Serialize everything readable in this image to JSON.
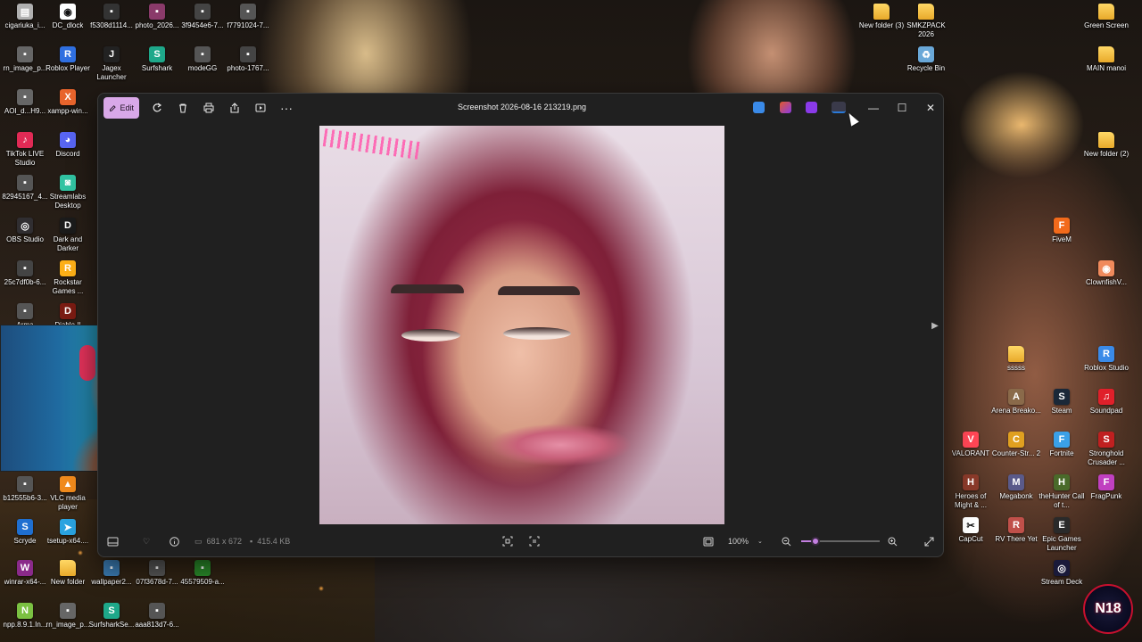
{
  "desktop": {
    "icons_left": [
      {
        "label": "cigariuka_i...",
        "color": "#b0b0b0",
        "glyph": "▤"
      },
      {
        "label": "DC_dlock",
        "color": "#ffffff",
        "glyph": "◉"
      },
      {
        "label": "f5308d1114...",
        "color": "#333333",
        "glyph": "▪"
      },
      {
        "label": "photo_2026...",
        "color": "#8a3a6a",
        "glyph": "▪"
      },
      {
        "label": "3f9454e6-7...",
        "color": "#444444",
        "glyph": "▪"
      },
      {
        "label": "f7791024-7...",
        "color": "#555555",
        "glyph": "▪"
      },
      {
        "label": "rn_image_p...",
        "color": "#666666",
        "glyph": "▪"
      },
      {
        "label": "Roblox Player",
        "color": "#2f6fe0",
        "glyph": "R"
      },
      {
        "label": "Jagex Launcher",
        "color": "#222222",
        "glyph": "J"
      },
      {
        "label": "Surfshark",
        "color": "#1ea88a",
        "glyph": "S"
      },
      {
        "label": "modeGG",
        "color": "#555555",
        "glyph": "▪"
      },
      {
        "label": "photo-1767...",
        "color": "#444444",
        "glyph": "▪"
      },
      {
        "label": "AOI_d...H9...",
        "color": "#666666",
        "glyph": "▪"
      },
      {
        "label": "xampp-win...",
        "color": "#e8642c",
        "glyph": "X"
      },
      {
        "label": "TikTok LIVE Studio",
        "color": "#e12a55",
        "glyph": "♪"
      },
      {
        "label": "Discord",
        "color": "#5865f2",
        "glyph": "◕"
      },
      {
        "label": "82945167_4...",
        "color": "#555555",
        "glyph": "▪"
      },
      {
        "label": "Streamlabs Desktop",
        "color": "#31c3a2",
        "glyph": "◙"
      },
      {
        "label": "OBS Studio",
        "color": "#302e31",
        "glyph": "◎"
      },
      {
        "label": "Dark and Darker",
        "color": "#1b1b1b",
        "glyph": "D"
      },
      {
        "label": "25c7df0b-6...",
        "color": "#444444",
        "glyph": "▪"
      },
      {
        "label": "Rockstar Games ...",
        "color": "#fcaf17",
        "glyph": "R"
      },
      {
        "label": "Arma",
        "color": "#555555",
        "glyph": "▪"
      },
      {
        "label": "Diablo II",
        "color": "#7a1b12",
        "glyph": "D"
      },
      {
        "label": "b12555b6-3...",
        "color": "#555555",
        "glyph": "▪"
      },
      {
        "label": "VLC media player",
        "color": "#f08a1c",
        "glyph": "▲"
      },
      {
        "label": "Scryde",
        "color": "#1f6fd0",
        "glyph": "S"
      },
      {
        "label": "tsetup-x64....",
        "color": "#2aa3e0",
        "glyph": "➤"
      },
      {
        "label": "winrar-x64-...",
        "color": "#8a2a8a",
        "glyph": "W"
      },
      {
        "label": "New folder",
        "color": "#e8a92a",
        "glyph": "folder"
      },
      {
        "label": "wallpaper2...",
        "color": "#3a7ab0",
        "glyph": "▪"
      },
      {
        "label": "07f3678d-7...",
        "color": "#555555",
        "glyph": "▪"
      },
      {
        "label": "45579509-a...",
        "color": "#2a8a2a",
        "glyph": "▪"
      },
      {
        "label": "npp.8.9.1.In...",
        "color": "#7bc142",
        "glyph": "N"
      },
      {
        "label": "rn_image_p...",
        "color": "#666666",
        "glyph": "▪"
      },
      {
        "label": "SurfsharkSe...",
        "color": "#1ea88a",
        "glyph": "S"
      },
      {
        "label": "aaa813d7-6...",
        "color": "#555555",
        "glyph": "▪"
      }
    ],
    "icons_right": [
      {
        "label": "New folder (3)",
        "glyph": "folder"
      },
      {
        "label": "SMKZPACK 2026",
        "glyph": "folder"
      },
      {
        "label": "Green Screen",
        "glyph": "folder"
      },
      {
        "label": "Recycle Bin",
        "color": "#6aa8d8",
        "glyph": "♻"
      },
      {
        "label": "MAIN manoi",
        "glyph": "folder"
      },
      {
        "label": "New folder (2)",
        "glyph": "folder"
      },
      {
        "label": "FiveM",
        "color": "#f26a1b",
        "glyph": "F"
      },
      {
        "label": "ClownfishV...",
        "color": "#f08a5c",
        "glyph": "◉"
      },
      {
        "label": "sssss",
        "glyph": "folder"
      },
      {
        "label": "Roblox Studio",
        "color": "#3a8ae8",
        "glyph": "R"
      },
      {
        "label": "Arena Breako...",
        "color": "#8a6a4a",
        "glyph": "A"
      },
      {
        "label": "Steam",
        "color": "#1b2838",
        "glyph": "S"
      },
      {
        "label": "Soundpad",
        "color": "#e0202a",
        "glyph": "♫"
      },
      {
        "label": "VALORANT",
        "color": "#ff4655",
        "glyph": "V"
      },
      {
        "label": "Counter-Str... 2",
        "color": "#e0a020",
        "glyph": "C"
      },
      {
        "label": "Fortnite",
        "color": "#3aa0e8",
        "glyph": "F"
      },
      {
        "label": "Stronghold Crusader ...",
        "color": "#c02020",
        "glyph": "S"
      },
      {
        "label": "Heroes of Might & ...",
        "color": "#8a3a2a",
        "glyph": "H"
      },
      {
        "label": "Megabonk",
        "color": "#5a5a8a",
        "glyph": "M"
      },
      {
        "label": "theHunter Call of t...",
        "color": "#4a6a2a",
        "glyph": "H"
      },
      {
        "label": "FragPunk",
        "color": "#c040c0",
        "glyph": "F"
      },
      {
        "label": "CapCut",
        "color": "#ffffff",
        "glyph": "✂"
      },
      {
        "label": "RV There Yet",
        "color": "#c0504a",
        "glyph": "R"
      },
      {
        "label": "Epic Games Launcher",
        "color": "#2a2a2a",
        "glyph": "E"
      },
      {
        "label": "Stream Deck",
        "color": "#1a1a3a",
        "glyph": "◎"
      }
    ],
    "logo_text": "N18"
  },
  "window": {
    "title": "Screenshot 2026-08-16 213219.png",
    "toolbar": {
      "edit_label": "Edit",
      "rotate_icon": "rotate-icon",
      "delete_icon": "trash-icon",
      "print_icon": "print-icon",
      "share_icon": "share-icon",
      "slideshow_icon": "slideshow-icon",
      "more_icon": "more-icon"
    },
    "app_icons": [
      {
        "name": "designer-icon",
        "color": "#3a8ae8"
      },
      {
        "name": "clipchamp-icon",
        "color": "#e05a2a"
      },
      {
        "name": "video-editor-icon",
        "color": "#8a3ae8"
      },
      {
        "name": "onedrive-icon",
        "color": "#2a7ad8"
      }
    ],
    "controls": {
      "minimize": "—",
      "maximize": "☐",
      "close": "✕"
    },
    "statusbar": {
      "dimensions": "681 x 672",
      "file_size": "415.4 KB",
      "zoom_value": "100%",
      "zoom_fraction": 0.18
    },
    "accent": "#c37fe0",
    "edit_button_color": "#d9a8e8"
  }
}
